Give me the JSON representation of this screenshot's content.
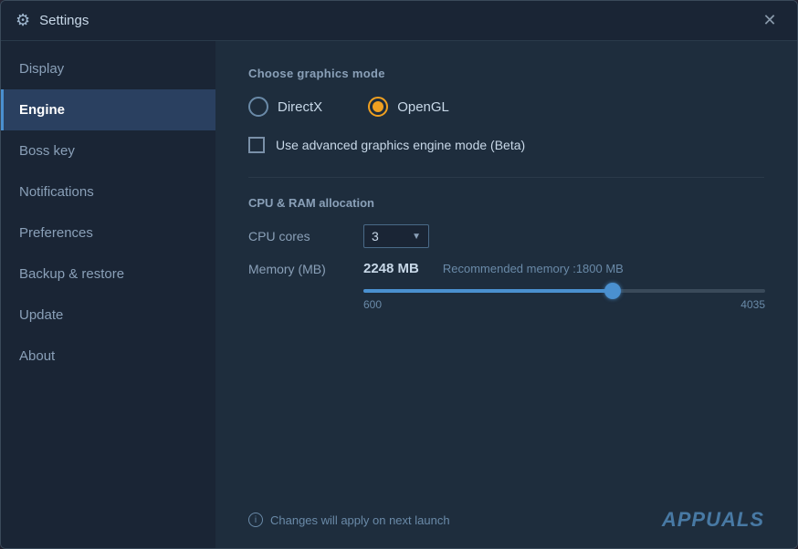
{
  "window": {
    "title": "Settings",
    "close_label": "✕"
  },
  "sidebar": {
    "items": [
      {
        "id": "display",
        "label": "Display",
        "active": false
      },
      {
        "id": "engine",
        "label": "Engine",
        "active": true
      },
      {
        "id": "boss-key",
        "label": "Boss key",
        "active": false
      },
      {
        "id": "notifications",
        "label": "Notifications",
        "active": false
      },
      {
        "id": "preferences",
        "label": "Preferences",
        "active": false
      },
      {
        "id": "backup-restore",
        "label": "Backup & restore",
        "active": false
      },
      {
        "id": "update",
        "label": "Update",
        "active": false
      },
      {
        "id": "about",
        "label": "About",
        "active": false
      }
    ]
  },
  "main": {
    "graphics_section_title": "Choose graphics mode",
    "graphics_options": [
      {
        "id": "directx",
        "label": "DirectX",
        "selected": false
      },
      {
        "id": "opengl",
        "label": "OpenGL",
        "selected": true
      }
    ],
    "advanced_checkbox_label": "Use advanced graphics engine mode (Beta)",
    "advanced_checked": false,
    "allocation_section_title": "CPU & RAM allocation",
    "cpu_label": "CPU cores",
    "cpu_value": "3",
    "memory_label": "Memory (MB)",
    "memory_value": "2248 MB",
    "memory_recommended": "Recommended memory :1800 MB",
    "slider_min": "600",
    "slider_max": "4035",
    "slider_fill_percent": 62,
    "footer_note": "Changes will apply on next launch",
    "brand_text": "APPUALS"
  }
}
